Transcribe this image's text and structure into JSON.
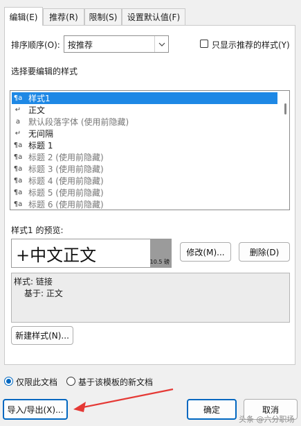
{
  "tabs": [
    "编辑(E)",
    "推荐(R)",
    "限制(S)",
    "设置默认值(F)"
  ],
  "sort": {
    "label": "排序顺序(O):",
    "value": "按推荐",
    "only_recommended": "只显示推荐的样式(Y)"
  },
  "select_label": "选择要编辑的样式",
  "styles": [
    {
      "icon": "¶a",
      "name": "样式1",
      "selected": true
    },
    {
      "icon": "↵",
      "name": "正文"
    },
    {
      "icon": "a",
      "name": "默认段落字体  (使用前隐藏)",
      "gray": true
    },
    {
      "icon": "↵",
      "name": "无间隔"
    },
    {
      "icon": "¶a",
      "name": "标题 1"
    },
    {
      "icon": "¶a",
      "name": "标题 2  (使用前隐藏)",
      "gray": true
    },
    {
      "icon": "¶a",
      "name": "标题 3  (使用前隐藏)",
      "gray": true
    },
    {
      "icon": "¶a",
      "name": "标题 4  (使用前隐藏)",
      "gray": true
    },
    {
      "icon": "¶a",
      "name": "标题 5  (使用前隐藏)",
      "gray": true
    },
    {
      "icon": "¶a",
      "name": "标题 6  (使用前隐藏)",
      "gray": true
    }
  ],
  "preview": {
    "label": "样式1 的预览:",
    "sample": "+中文正文",
    "size": "10.5 磅"
  },
  "buttons": {
    "modify": "修改(M)...",
    "delete": "删除(D)",
    "new_style": "新建样式(N)...",
    "import_export": "导入/导出(X)...",
    "ok": "确定",
    "cancel": "取消"
  },
  "description": {
    "line1": "样式: 链接",
    "line2": "基于: 正文"
  },
  "scope": {
    "only_doc": "仅限此文档",
    "template": "基于该模板的新文档"
  },
  "watermark": "头条 @六分职场",
  "colors": {
    "selection": "#1e88e5",
    "annotation_arrow": "#e53935",
    "primary_border": "#0067c0"
  }
}
